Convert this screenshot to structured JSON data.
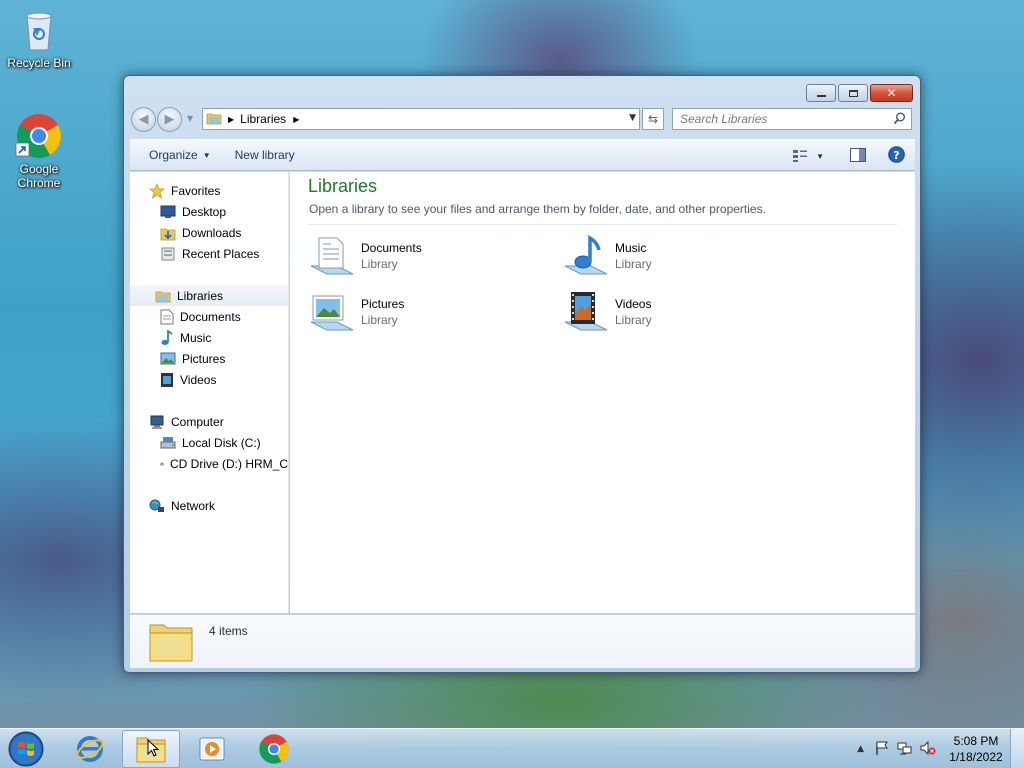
{
  "desktop": {
    "icons": [
      {
        "label": "Recycle Bin"
      },
      {
        "label": "Google Chrome"
      }
    ]
  },
  "window": {
    "buttons": {
      "minimize": "–",
      "maximize": "▭",
      "close": "✕"
    },
    "address": {
      "crumb": "Libraries"
    },
    "search": {
      "placeholder": "Search Libraries"
    },
    "toolbar": {
      "organize": "Organize",
      "new_library": "New library"
    },
    "nav": {
      "favorites": "Favorites",
      "desktop": "Desktop",
      "downloads": "Downloads",
      "recent": "Recent Places",
      "libraries": "Libraries",
      "documents": "Documents",
      "music": "Music",
      "pictures": "Pictures",
      "videos": "Videos",
      "computer": "Computer",
      "local_disk": "Local Disk (C:)",
      "cd_drive": "CD Drive (D:) HRM_C",
      "network": "Network"
    },
    "content": {
      "title": "Libraries",
      "subtitle": "Open a library to see your files and arrange them by folder, date, and other properties.",
      "libraries": [
        {
          "name": "Documents",
          "kind": "Library"
        },
        {
          "name": "Music",
          "kind": "Library"
        },
        {
          "name": "Pictures",
          "kind": "Library"
        },
        {
          "name": "Videos",
          "kind": "Library"
        }
      ]
    },
    "details": {
      "count": "4 items"
    }
  },
  "taskbar": {
    "clock": {
      "time": "5:08 PM",
      "date": "1/18/2022"
    }
  }
}
